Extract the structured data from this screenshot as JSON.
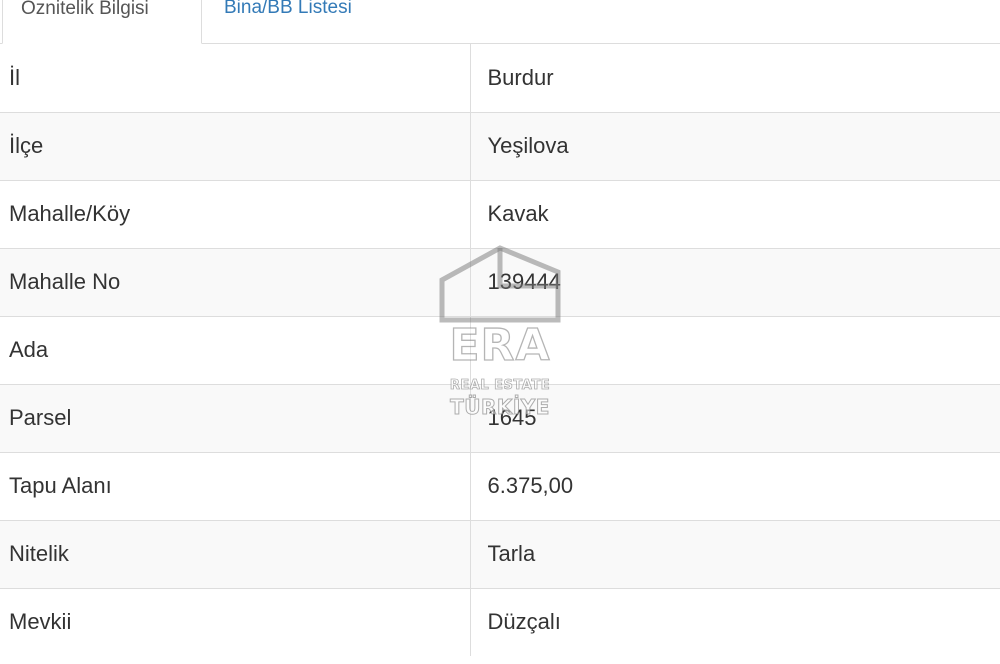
{
  "tabs": [
    {
      "label": "Öznitelik Bilgisi",
      "active": true
    },
    {
      "label": "Bina/BB Listesi",
      "active": false
    }
  ],
  "rows": [
    {
      "key": "İl",
      "value": "Burdur"
    },
    {
      "key": "İlçe",
      "value": "Yeşilova"
    },
    {
      "key": "Mahalle/Köy",
      "value": "Kavak"
    },
    {
      "key": "Mahalle No",
      "value": "139444"
    },
    {
      "key": "Ada",
      "value": ""
    },
    {
      "key": "Parsel",
      "value": "1645"
    },
    {
      "key": "Tapu Alanı",
      "value": "6.375,00"
    },
    {
      "key": "Nitelik",
      "value": "Tarla"
    },
    {
      "key": "Mevkii",
      "value": "Düzçalı"
    }
  ],
  "watermark": {
    "brand": "ERA",
    "line1": "REAL ESTATE",
    "line2": "TÜRKİYE",
    "icon": "house-outline-icon"
  },
  "colors": {
    "link": "#337ab7",
    "border": "#dddddd",
    "stripe": "#f9f9f9"
  }
}
